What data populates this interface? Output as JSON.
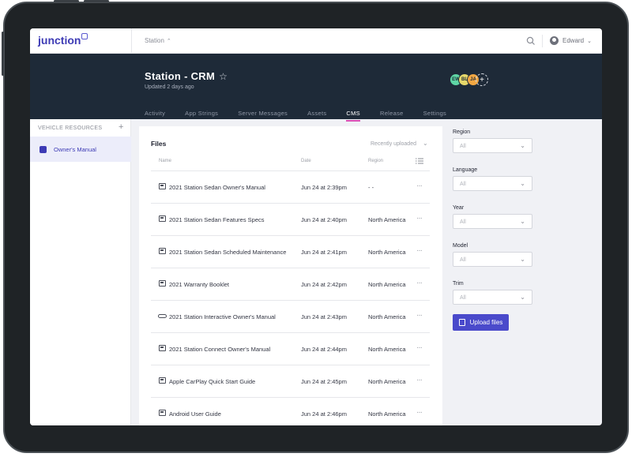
{
  "app": {
    "logo": "junction",
    "breadcrumb": "Station",
    "user": "Edward"
  },
  "project": {
    "title": "Station - CRM",
    "updated": "Updated 2 days ago",
    "avatars": [
      {
        "initials": "EW",
        "color": "#5fd6a5"
      },
      {
        "initials": "BL",
        "color": "#e6d86b"
      },
      {
        "initials": "JA",
        "color": "#f2a742"
      }
    ],
    "tabs": [
      {
        "label": "Activity",
        "active": false
      },
      {
        "label": "App Strings",
        "active": false
      },
      {
        "label": "Server Messages",
        "active": false
      },
      {
        "label": "Assets",
        "active": false
      },
      {
        "label": "CMS",
        "active": true
      },
      {
        "label": "Release",
        "active": false
      },
      {
        "label": "Settings",
        "active": false
      }
    ]
  },
  "sidebar": {
    "heading": "VEHICLE RESOURCES",
    "items": [
      {
        "label": "Owner's Manual",
        "active": true
      }
    ]
  },
  "files": {
    "title": "Files",
    "sort": "Recently uploaded",
    "columns": {
      "name": "Name",
      "date": "Date",
      "region": "Region"
    },
    "rows": [
      {
        "icon": "file",
        "name": "2021 Station Sedan Owner's Manual",
        "date": "Jun 24 at 2:39pm",
        "region": "- -"
      },
      {
        "icon": "file",
        "name": "2021 Station Sedan Features Specs",
        "date": "Jun 24 at 2:40pm",
        "region": "North America"
      },
      {
        "icon": "file",
        "name": "2021 Station Sedan Scheduled Maintenance",
        "date": "Jun 24 at 2:41pm",
        "region": "North America"
      },
      {
        "icon": "file",
        "name": "2021 Warranty Booklet",
        "date": "Jun 24 at 2:42pm",
        "region": "North America"
      },
      {
        "icon": "link",
        "name": "2021 Station Interactive Owner's Manual",
        "date": "Jun 24 at 2:43pm",
        "region": "North America"
      },
      {
        "icon": "file",
        "name": "2021 Station Connect Owner's Manual",
        "date": "Jun 24 at 2:44pm",
        "region": "North America"
      },
      {
        "icon": "file",
        "name": "Apple CarPlay Quick Start Guide",
        "date": "Jun 24 at 2:45pm",
        "region": "North America"
      },
      {
        "icon": "file",
        "name": "Android User Guide",
        "date": "Jun 24 at 2:46pm",
        "region": "North America"
      }
    ]
  },
  "filters": [
    {
      "label": "Region",
      "value": "All"
    },
    {
      "label": "Language",
      "value": "All"
    },
    {
      "label": "Year",
      "value": "All"
    },
    {
      "label": "Model",
      "value": "All"
    },
    {
      "label": "Trim",
      "value": "All"
    }
  ],
  "upload_label": "Upload files"
}
